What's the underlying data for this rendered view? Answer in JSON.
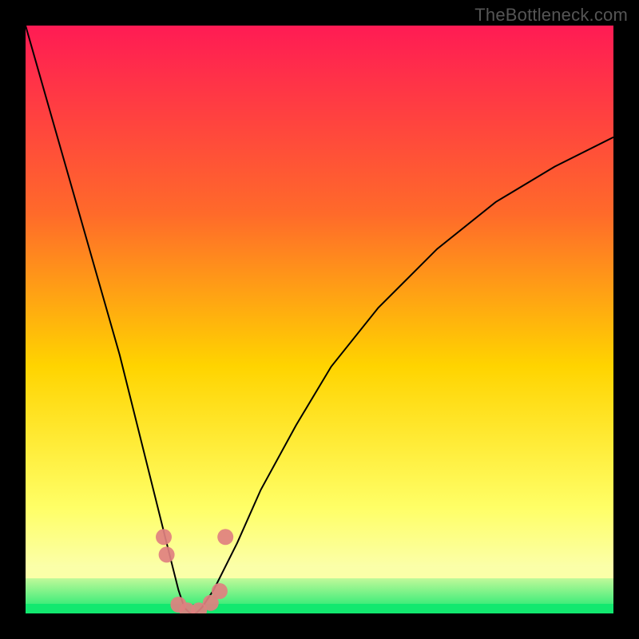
{
  "watermark": "TheBottleneck.com",
  "chart_data": {
    "type": "line",
    "title": "",
    "xlabel": "",
    "ylabel": "",
    "xlim": [
      0,
      100
    ],
    "ylim": [
      0,
      100
    ],
    "grid": false,
    "legend": false,
    "background_gradient": {
      "top_color": "#ff1b54",
      "upper_mid_color": "#ff6a2a",
      "mid_color": "#ffd400",
      "lower_mid_color": "#ffff66",
      "band_color": "#fbffa8",
      "bottom_color": "#12e86f"
    },
    "series": [
      {
        "name": "curve",
        "x": [
          0,
          4,
          8,
          12,
          16,
          18,
          20,
          22,
          24,
          26,
          27,
          28,
          29,
          30,
          32,
          36,
          40,
          46,
          52,
          60,
          70,
          80,
          90,
          100
        ],
        "y": [
          100,
          86,
          72,
          58,
          44,
          36,
          28,
          20,
          12,
          4,
          1,
          0,
          0,
          1,
          4,
          12,
          21,
          32,
          42,
          52,
          62,
          70,
          76,
          81
        ]
      }
    ],
    "markers": {
      "name": "highlighted-points",
      "color": "#e08080",
      "radius": 10,
      "points": [
        {
          "x": 23.5,
          "y": 13
        },
        {
          "x": 24.0,
          "y": 10
        },
        {
          "x": 26.0,
          "y": 1.5
        },
        {
          "x": 27.5,
          "y": 0.5
        },
        {
          "x": 29.5,
          "y": 0.5
        },
        {
          "x": 31.5,
          "y": 1.8
        },
        {
          "x": 33.0,
          "y": 3.8
        },
        {
          "x": 34.0,
          "y": 13
        }
      ]
    }
  }
}
